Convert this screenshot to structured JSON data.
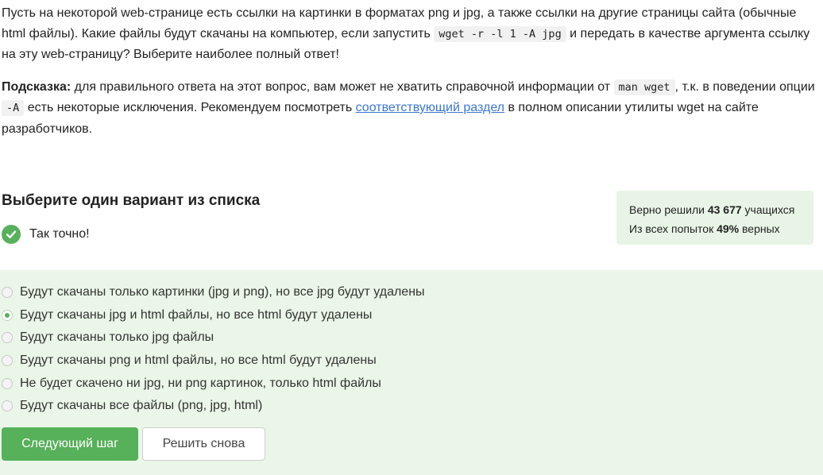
{
  "question": {
    "p1_before": "Пусть на некоторой web-странице есть ссылки на картинки в форматах png и jpg, а также ссылки на другие страницы сайта (обычные html файлы). Какие файлы будут скачаны на компьютер, если запустить ",
    "p1_code": "wget -r -l 1 -A jpg",
    "p1_after": " и передать в качестве аргумента ссылку на эту web-страницу? Выберите наиболее полный ответ!",
    "hint_label": "Подсказка:",
    "hint_before": " для правильного ответа на этот вопрос, вам может не хватить справочной информации от ",
    "hint_code1": "man wget",
    "hint_mid": ", т.к. в поведении опции ",
    "hint_code2": "-A",
    "hint_mid2": " есть некоторые исключения. Рекомендуем посмотреть ",
    "hint_link": "соответствующий раздел",
    "hint_after": " в полном описании утилиты wget на сайте разработчиков."
  },
  "section_title": "Выберите один вариант из списка",
  "result": {
    "text": "Так точно!"
  },
  "stats": {
    "line1_before": "Верно решили ",
    "solved_count": "43 677",
    "line1_after": " учащихся",
    "line2_before": "Из всех попыток ",
    "percent": "49%",
    "line2_after": " верных"
  },
  "options": [
    {
      "label": "Будут скачаны только картинки (jpg и png), но все jpg будут удалены",
      "checked": false
    },
    {
      "label": "Будут скачаны jpg и html файлы, но все html будут удалены",
      "checked": true
    },
    {
      "label": "Будут скачаны только jpg файлы",
      "checked": false
    },
    {
      "label": "Будут скачаны png и html файлы, но все html будут удалены",
      "checked": false
    },
    {
      "label": "Не будет скачено ни jpg, ни png картинок, только html файлы",
      "checked": false
    },
    {
      "label": "Будут скачаны все файлы (png, jpg, html)",
      "checked": false
    }
  ],
  "buttons": {
    "next": "Следующий шаг",
    "retry": "Решить снова"
  },
  "colors": {
    "accent": "#57b05a",
    "panel_bg": "#eaf6e7",
    "link": "#3b76d4"
  },
  "icons": {
    "result": "check-circle-icon"
  }
}
